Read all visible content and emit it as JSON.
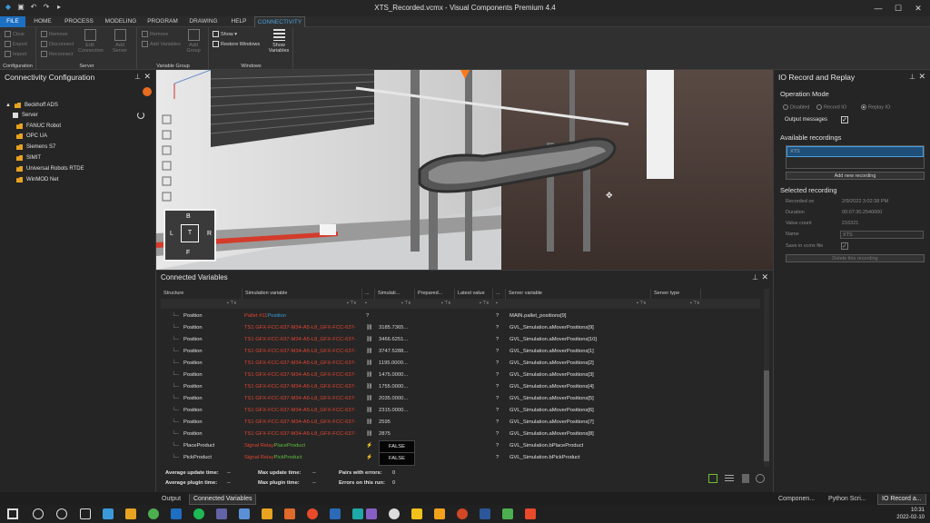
{
  "window": {
    "title": "XTS_Recorded.vcmx - Visual Components Premium 4.4",
    "controls": [
      "—",
      "☐",
      "✕"
    ]
  },
  "menu": {
    "tabs": [
      "FILE",
      "HOME",
      "PROCESS",
      "MODELING",
      "PROGRAM",
      "DRAWING",
      "HELP",
      "CONNECTIVITY"
    ],
    "active": "CONNECTIVITY"
  },
  "ribbon": {
    "configuration": {
      "label": "Configuration",
      "items": [
        "Clear",
        "Export",
        "Import"
      ]
    },
    "server": {
      "label": "Server",
      "items": [
        "Remove",
        "Disconnect",
        "Reconnect"
      ],
      "edit": "Edit Connection",
      "add": "Add Server"
    },
    "variable_group": {
      "label": "Variable Group",
      "items": [
        "Remove",
        "Add Variables"
      ],
      "add": "Add Group"
    },
    "windows": {
      "label": "Windows",
      "show": "Show ▾",
      "restore": "Restore Windows",
      "show_variables": "Show Variables"
    }
  },
  "left_panel": {
    "title": "Connectivity Configuration",
    "items": [
      {
        "label": "Beckhoff ADS",
        "type": "folder",
        "expanded": true
      },
      {
        "label": "Server",
        "type": "server",
        "child": true
      },
      {
        "label": "FANUC Robot",
        "type": "folder"
      },
      {
        "label": "OPC UA",
        "type": "folder"
      },
      {
        "label": "Siemens S7",
        "type": "folder"
      },
      {
        "label": "SIMIT",
        "type": "folder"
      },
      {
        "label": "Universal Robots RTDE",
        "type": "folder"
      },
      {
        "label": "WinMOD Net",
        "type": "folder"
      }
    ]
  },
  "connected_variables": {
    "title": "Connected Variables",
    "columns": [
      "Structure",
      "Simulation variable",
      "...",
      "Simulati...",
      "Prepared...",
      "Latest value",
      "...",
      "Server variable",
      "Server type"
    ],
    "rows": [
      {
        "structure": "Position",
        "sim_prefix": "Pallet #11",
        "sim_suffix": "Position",
        "sim_value": "",
        "server_var": "MAIN.pallet_positions[9]"
      },
      {
        "structure": "Position",
        "sim_prefix": "TS1 GFX-FCC-637-M34-A5-L8_GFX-FCC-637-",
        "sim_suffix": "",
        "sim_value": "3185.7365...",
        "server_var": "GVL_Simulation.aMoverPositions[9]"
      },
      {
        "structure": "Position",
        "sim_prefix": "TS1 GFX-FCC-637-M34-A5-L8_GFX-FCC-637-",
        "sim_suffix": "",
        "sim_value": "3466.6251...",
        "server_var": "GVL_Simulation.aMoverPositions[10]"
      },
      {
        "structure": "Position",
        "sim_prefix": "TS1 GFX-FCC-637-M34-A5-L8_GFX-FCC-637-",
        "sim_suffix": "",
        "sim_value": "3747.5288...",
        "server_var": "GVL_Simulation.aMoverPositions[1]"
      },
      {
        "structure": "Position",
        "sim_prefix": "TS1 GFX-FCC-637-M34-A5-L8_GFX-FCC-637-",
        "sim_suffix": "",
        "sim_value": "1195.0000...",
        "server_var": "GVL_Simulation.aMoverPositions[2]"
      },
      {
        "structure": "Position",
        "sim_prefix": "TS1 GFX-FCC-637-M34-A5-L8_GFX-FCC-637-",
        "sim_suffix": "",
        "sim_value": "1475.0000...",
        "server_var": "GVL_Simulation.aMoverPositions[3]"
      },
      {
        "structure": "Position",
        "sim_prefix": "TS1 GFX-FCC-637-M34-A5-L8_GFX-FCC-637-",
        "sim_suffix": "",
        "sim_value": "1755.0000...",
        "server_var": "GVL_Simulation.aMoverPositions[4]"
      },
      {
        "structure": "Position",
        "sim_prefix": "TS1 GFX-FCC-637-M34-A5-L8_GFX-FCC-637-",
        "sim_suffix": "",
        "sim_value": "2035.0000...",
        "server_var": "GVL_Simulation.aMoverPositions[5]"
      },
      {
        "structure": "Position",
        "sim_prefix": "TS1 GFX-FCC-637-M34-A5-L8_GFX-FCC-637-",
        "sim_suffix": "",
        "sim_value": "2315.0000...",
        "server_var": "GVL_Simulation.aMoverPositions[6]"
      },
      {
        "structure": "Position",
        "sim_prefix": "TS1 GFX-FCC-637-M34-A5-L8_GFX-FCC-637-",
        "sim_suffix": "",
        "sim_value": "2595",
        "server_var": "GVL_Simulation.aMoverPositions[7]"
      },
      {
        "structure": "Position",
        "sim_prefix": "TS1 GFX-FCC-637-M34-A5-L8_GFX-FCC-637-",
        "sim_suffix": "",
        "sim_value": "2875",
        "server_var": "GVL_Simulation.aMoverPositions[8]"
      },
      {
        "structure": "PlaceProduct",
        "sim_prefix": "Signal Relay",
        "sim_suffix": "PlaceProduct",
        "sim_value": "FALSE",
        "server_var": "GVL_Simulation.bPlaceProduct"
      },
      {
        "structure": "PickProduct",
        "sim_prefix": "Signal Relay",
        "sim_suffix": "PickProduct",
        "sim_value": "FALSE",
        "server_var": "GVL_Simulation.bPickProduct"
      }
    ],
    "stats": {
      "avg_update_label": "Average update time:",
      "avg_update": "--",
      "max_update_label": "Max update time:",
      "max_update": "--",
      "pairs_errors_label": "Pairs with errors:",
      "pairs_errors": "0",
      "avg_plugin_label": "Average plugin time:",
      "avg_plugin": "--",
      "max_plugin_label": "Max plugin time:",
      "max_plugin": "--",
      "errors_run_label": "Errors on this run:",
      "errors_run": "0"
    }
  },
  "right_panel": {
    "title": "IO Record and Replay",
    "operation_mode": "Operation Mode",
    "modes": [
      "Disabled",
      "Record IO",
      "Replay IO"
    ],
    "output_messages": "Output messages",
    "available_recordings": "Available recordings",
    "recording_item": "XTS",
    "add_recording": "Add new recording",
    "selected_recording": "Selected recording",
    "fields": [
      {
        "label": "Recorded on",
        "value": "2/9/2022 3:02:38 PM"
      },
      {
        "label": "Duration",
        "value": "00:07:30.2540000"
      },
      {
        "label": "Value count",
        "value": "216321"
      },
      {
        "label": "Name",
        "value": "XTS"
      }
    ],
    "save_in_file": "Save in vcmx file",
    "delete_recording": "Delete this recording"
  },
  "bottom_tabs": {
    "left": [
      "Output",
      "Connected Variables"
    ],
    "right": [
      "Componen...",
      "Python Scri...",
      "IO Record a..."
    ]
  },
  "viewcube": {
    "top": "B",
    "left": "L",
    "center": "T",
    "right": "R",
    "bottom": "F"
  },
  "taskbar": {
    "time": "10:31",
    "date": "2022-02-10"
  }
}
